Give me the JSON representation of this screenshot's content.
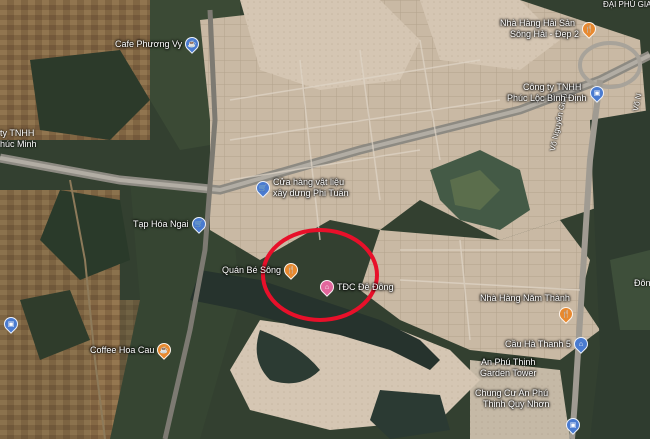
{
  "map": {
    "colors": {
      "highlight_ring": "#e8102a",
      "pin_blue": "#4a7bd0",
      "pin_orange": "#e8892f",
      "pin_pink": "#e2669c"
    },
    "area_labels": {
      "top": "ĐẠI PHÚ GIA",
      "left_1": "ty TNHH",
      "left_2": "húc Minh",
      "right_edge": "Đôn"
    },
    "roads": {
      "vo_nguyen_giap": "Võ Nguyên Giáp",
      "vo": "Võ N"
    },
    "pois": {
      "cafe_phuong_vy": {
        "name": "Cafe Phương Vy",
        "icon": "cafe-icon"
      },
      "nha_hang_hai_san": {
        "name_line1": "Nhà Hàng Hải Sản",
        "name_line2": "Sông Hải - Đẹp 2",
        "icon": "restaurant-icon"
      },
      "cong_ty_phuc_loc": {
        "name_line1": "Công ty TNHH",
        "name_line2": "Phúc Lộc Bình Định",
        "icon": "building-icon"
      },
      "cua_hang_vat_lieu": {
        "name_line1": "Cửa hàng vật liệu",
        "name_line2": "xây dựng Phi Tuấn",
        "icon": "shop-icon"
      },
      "tap_hoa_ngai": {
        "name": "Tạp Hóa Ngai",
        "icon": "grocery-icon"
      },
      "quan_be_song": {
        "name": "Quán Bé Sông",
        "icon": "restaurant-icon"
      },
      "tdc_de_dong": {
        "name": "TĐC Đê Đông",
        "icon": "hotel-icon"
      },
      "nha_hang_nam_thanh": {
        "name": "Nhà Hàng Năm Thành",
        "icon": "restaurant-icon"
      },
      "cau_ha_thanh": {
        "name": "Cầu Hà Thanh 5",
        "icon": "landmark-icon"
      },
      "coffee_hoa_cau": {
        "name": "Coffee Hoa Cau",
        "icon": "cafe-icon"
      },
      "an_phu_thinh_garden": {
        "name_line1": "An Phú Thịnh",
        "name_line2": "Garden Tower",
        "icon": "building-icon"
      },
      "chung_cu_an_phu": {
        "name_line1": "Chung Cư An Phú",
        "name_line2": "Thịnh Quy Nhơn",
        "icon": "building-icon"
      },
      "left_company": {
        "icon": "building-icon"
      }
    }
  }
}
